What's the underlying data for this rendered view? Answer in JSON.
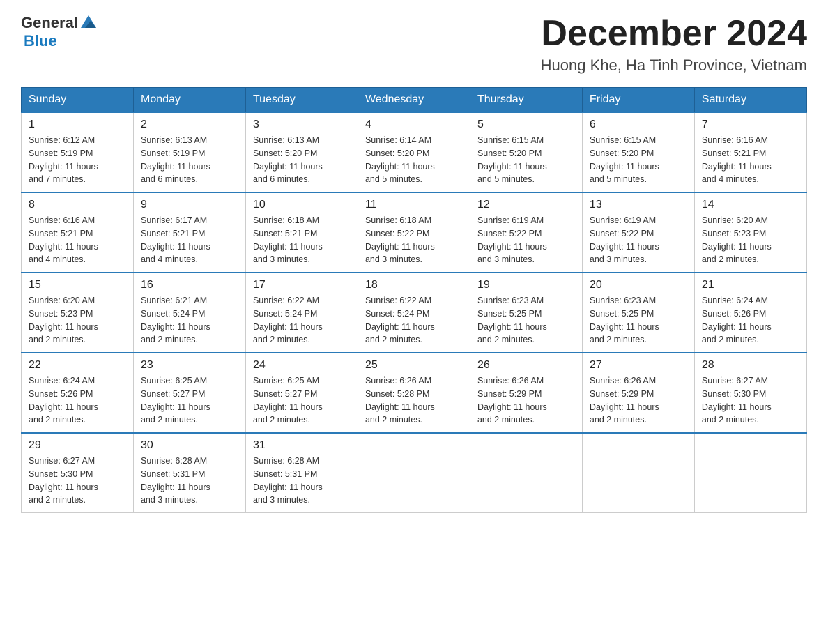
{
  "header": {
    "logo_general": "General",
    "logo_blue": "Blue",
    "month": "December 2024",
    "location": "Huong Khe, Ha Tinh Province, Vietnam"
  },
  "weekdays": [
    "Sunday",
    "Monday",
    "Tuesday",
    "Wednesday",
    "Thursday",
    "Friday",
    "Saturday"
  ],
  "weeks": [
    [
      {
        "day": "1",
        "info": "Sunrise: 6:12 AM\nSunset: 5:19 PM\nDaylight: 11 hours\nand 7 minutes."
      },
      {
        "day": "2",
        "info": "Sunrise: 6:13 AM\nSunset: 5:19 PM\nDaylight: 11 hours\nand 6 minutes."
      },
      {
        "day": "3",
        "info": "Sunrise: 6:13 AM\nSunset: 5:20 PM\nDaylight: 11 hours\nand 6 minutes."
      },
      {
        "day": "4",
        "info": "Sunrise: 6:14 AM\nSunset: 5:20 PM\nDaylight: 11 hours\nand 5 minutes."
      },
      {
        "day": "5",
        "info": "Sunrise: 6:15 AM\nSunset: 5:20 PM\nDaylight: 11 hours\nand 5 minutes."
      },
      {
        "day": "6",
        "info": "Sunrise: 6:15 AM\nSunset: 5:20 PM\nDaylight: 11 hours\nand 5 minutes."
      },
      {
        "day": "7",
        "info": "Sunrise: 6:16 AM\nSunset: 5:21 PM\nDaylight: 11 hours\nand 4 minutes."
      }
    ],
    [
      {
        "day": "8",
        "info": "Sunrise: 6:16 AM\nSunset: 5:21 PM\nDaylight: 11 hours\nand 4 minutes."
      },
      {
        "day": "9",
        "info": "Sunrise: 6:17 AM\nSunset: 5:21 PM\nDaylight: 11 hours\nand 4 minutes."
      },
      {
        "day": "10",
        "info": "Sunrise: 6:18 AM\nSunset: 5:21 PM\nDaylight: 11 hours\nand 3 minutes."
      },
      {
        "day": "11",
        "info": "Sunrise: 6:18 AM\nSunset: 5:22 PM\nDaylight: 11 hours\nand 3 minutes."
      },
      {
        "day": "12",
        "info": "Sunrise: 6:19 AM\nSunset: 5:22 PM\nDaylight: 11 hours\nand 3 minutes."
      },
      {
        "day": "13",
        "info": "Sunrise: 6:19 AM\nSunset: 5:22 PM\nDaylight: 11 hours\nand 3 minutes."
      },
      {
        "day": "14",
        "info": "Sunrise: 6:20 AM\nSunset: 5:23 PM\nDaylight: 11 hours\nand 2 minutes."
      }
    ],
    [
      {
        "day": "15",
        "info": "Sunrise: 6:20 AM\nSunset: 5:23 PM\nDaylight: 11 hours\nand 2 minutes."
      },
      {
        "day": "16",
        "info": "Sunrise: 6:21 AM\nSunset: 5:24 PM\nDaylight: 11 hours\nand 2 minutes."
      },
      {
        "day": "17",
        "info": "Sunrise: 6:22 AM\nSunset: 5:24 PM\nDaylight: 11 hours\nand 2 minutes."
      },
      {
        "day": "18",
        "info": "Sunrise: 6:22 AM\nSunset: 5:24 PM\nDaylight: 11 hours\nand 2 minutes."
      },
      {
        "day": "19",
        "info": "Sunrise: 6:23 AM\nSunset: 5:25 PM\nDaylight: 11 hours\nand 2 minutes."
      },
      {
        "day": "20",
        "info": "Sunrise: 6:23 AM\nSunset: 5:25 PM\nDaylight: 11 hours\nand 2 minutes."
      },
      {
        "day": "21",
        "info": "Sunrise: 6:24 AM\nSunset: 5:26 PM\nDaylight: 11 hours\nand 2 minutes."
      }
    ],
    [
      {
        "day": "22",
        "info": "Sunrise: 6:24 AM\nSunset: 5:26 PM\nDaylight: 11 hours\nand 2 minutes."
      },
      {
        "day": "23",
        "info": "Sunrise: 6:25 AM\nSunset: 5:27 PM\nDaylight: 11 hours\nand 2 minutes."
      },
      {
        "day": "24",
        "info": "Sunrise: 6:25 AM\nSunset: 5:27 PM\nDaylight: 11 hours\nand 2 minutes."
      },
      {
        "day": "25",
        "info": "Sunrise: 6:26 AM\nSunset: 5:28 PM\nDaylight: 11 hours\nand 2 minutes."
      },
      {
        "day": "26",
        "info": "Sunrise: 6:26 AM\nSunset: 5:29 PM\nDaylight: 11 hours\nand 2 minutes."
      },
      {
        "day": "27",
        "info": "Sunrise: 6:26 AM\nSunset: 5:29 PM\nDaylight: 11 hours\nand 2 minutes."
      },
      {
        "day": "28",
        "info": "Sunrise: 6:27 AM\nSunset: 5:30 PM\nDaylight: 11 hours\nand 2 minutes."
      }
    ],
    [
      {
        "day": "29",
        "info": "Sunrise: 6:27 AM\nSunset: 5:30 PM\nDaylight: 11 hours\nand 2 minutes."
      },
      {
        "day": "30",
        "info": "Sunrise: 6:28 AM\nSunset: 5:31 PM\nDaylight: 11 hours\nand 3 minutes."
      },
      {
        "day": "31",
        "info": "Sunrise: 6:28 AM\nSunset: 5:31 PM\nDaylight: 11 hours\nand 3 minutes."
      },
      null,
      null,
      null,
      null
    ]
  ]
}
